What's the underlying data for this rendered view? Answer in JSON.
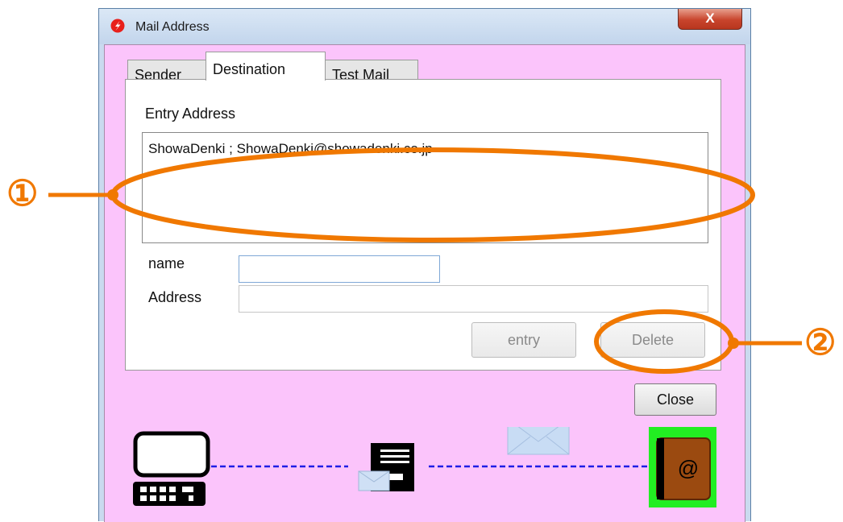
{
  "window": {
    "title": "Mail Address",
    "close_label": "X"
  },
  "tabs": [
    {
      "label": "Sender"
    },
    {
      "label": "Destination"
    },
    {
      "label": "Test Mail"
    }
  ],
  "panel": {
    "entry_label": "Entry Address",
    "entries": [
      "ShowaDenki ; ShowaDenki@showadenki.co.jp"
    ],
    "name_label": "name",
    "address_label": "Address",
    "name_value": "",
    "address_value": "",
    "entry_button": "entry",
    "delete_button": "Delete"
  },
  "close_button": "Close",
  "annotations": {
    "callout_1": "①",
    "callout_2": "②"
  },
  "status_diagram": {
    "icons": [
      "computer-icon",
      "mail-server-icon",
      "envelope-icon",
      "address-book-icon"
    ],
    "address_book_glyph": "@"
  },
  "colors": {
    "client_background": "#fbc4fb",
    "annotation": "#f07800",
    "link_line": "#1e1ee6",
    "address_book_frame": "#22ee22"
  }
}
